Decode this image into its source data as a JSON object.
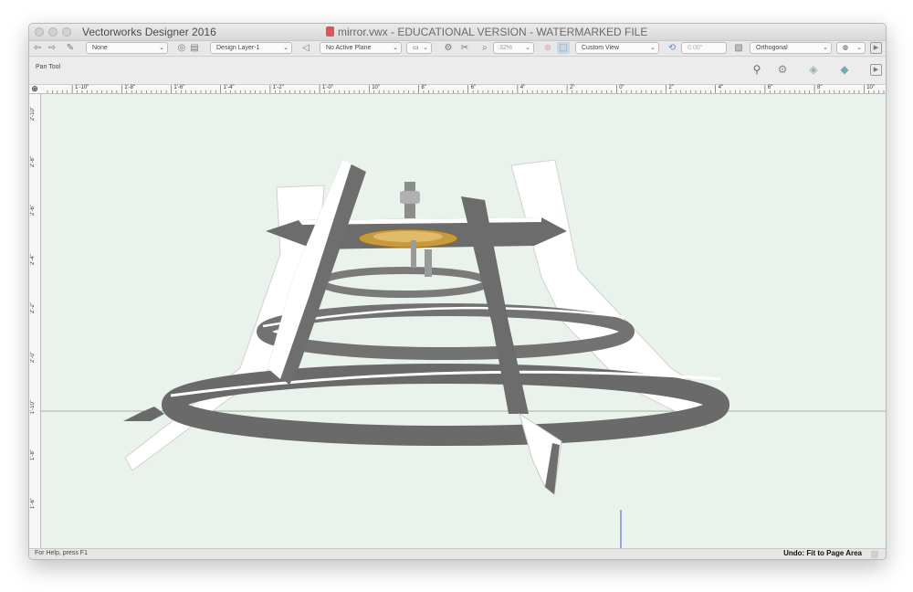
{
  "window": {
    "app_title": "Vectorworks Designer 2016",
    "doc_title": "mirror.vwx - EDUCATIONAL VERSION - WATERMARKED FILE"
  },
  "toolbar": {
    "class_select": "None",
    "layer_select": "Design Layer-1",
    "plane_select": "No Active Plane",
    "zoom_value": "32%",
    "view_select": "Custom View",
    "angle_value": "0.00°",
    "projection_select": "Orthogonal"
  },
  "tool": {
    "name": "Pan Tool"
  },
  "ruler": {
    "horizontal": [
      "1'-10\"",
      "1'-8\"",
      "1'-6\"",
      "1'-4\"",
      "1'-2\"",
      "1'-0\"",
      "10\"",
      "8\"",
      "6\"",
      "4\"",
      "2\"",
      "0\"",
      "2\"",
      "4\"",
      "6\"",
      "8\"",
      "10\""
    ],
    "vertical": [
      "2'-10\"",
      "2'-8\"",
      "2'-6\"",
      "2'-4\"",
      "2'-2\"",
      "2'-0\"",
      "1'-10\"",
      "1'-8\"",
      "1'-6\""
    ]
  },
  "status": {
    "help": "For Help, press F1",
    "undo": "Undo: Fit to Page Area"
  },
  "colors": {
    "canvas": "#e9f3eb",
    "model_light": "#ffffff",
    "model_dark": "#6e6e6e",
    "gear": "#c89a3c"
  }
}
